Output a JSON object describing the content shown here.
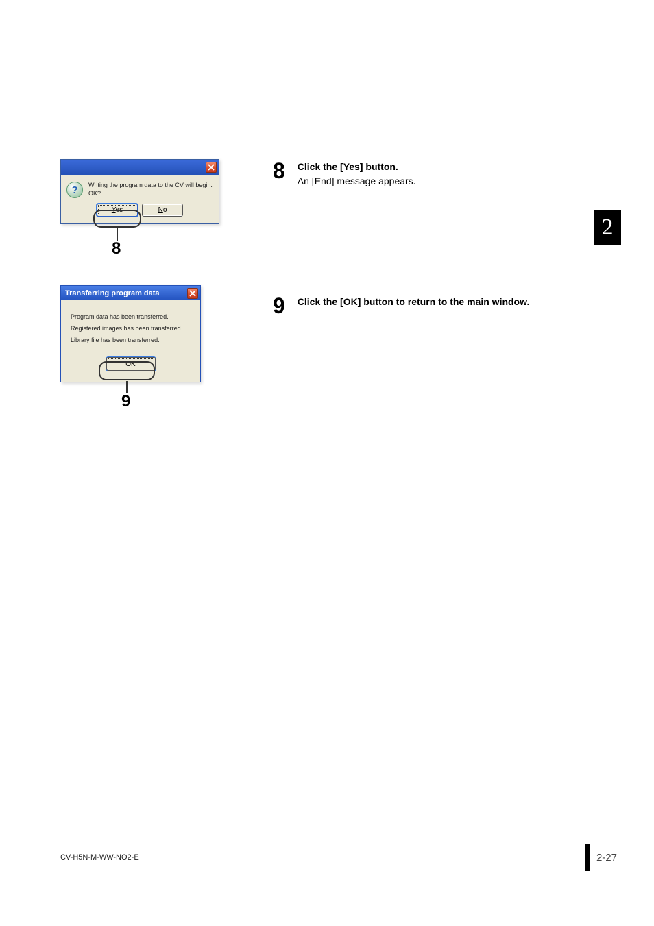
{
  "chapter": "2",
  "footer": {
    "code": "CV-H5N-M-WW-NO2-E",
    "page": "2-27"
  },
  "step8": {
    "num": "8",
    "title": "Click the [Yes] button.",
    "desc": "An [End] message appears."
  },
  "step9": {
    "num": "9",
    "title": "Click the [OK] button to return to the main window."
  },
  "dlg1": {
    "msg_l1": "Writing the program data to the CV will begin.",
    "msg_l2": "OK?",
    "yes_pre": "Y",
    "yes_rest": "es",
    "no_pre": "N",
    "no_rest": "o",
    "callout": "8"
  },
  "dlg2": {
    "title": "Transferring program data",
    "line1": "Program data has been transferred.",
    "line2": "Registered images has been transferred.",
    "line3": "Library file has been transferred.",
    "ok": "OK",
    "callout": "9"
  }
}
